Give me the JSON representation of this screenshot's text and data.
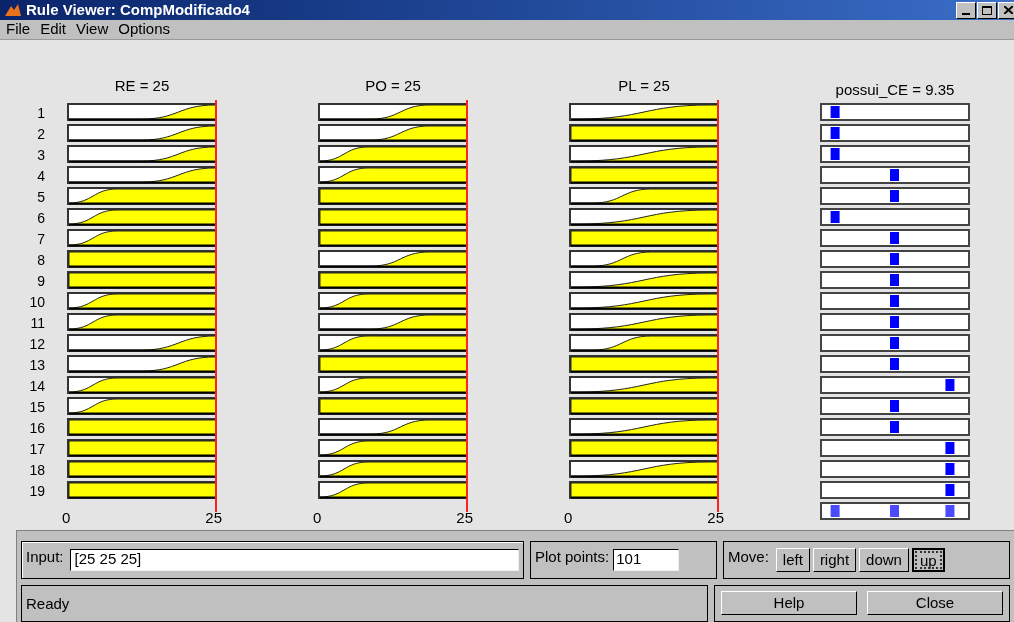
{
  "window": {
    "title": "Rule Viewer: CompModificado4"
  },
  "menu": [
    "File",
    "Edit",
    "View",
    "Options"
  ],
  "rule_numbers": [
    "1",
    "2",
    "3",
    "4",
    "5",
    "6",
    "7",
    "8",
    "9",
    "10",
    "11",
    "12",
    "13",
    "14",
    "15",
    "16",
    "17",
    "18",
    "19"
  ],
  "inputs": [
    {
      "label": "RE = 25",
      "axis_min": "0",
      "axis_max": "25",
      "rules": [
        {
          "kind": "late"
        },
        {
          "kind": "late"
        },
        {
          "kind": "late"
        },
        {
          "kind": "late"
        },
        {
          "kind": "early"
        },
        {
          "kind": "early"
        },
        {
          "kind": "early"
        },
        {
          "kind": "full"
        },
        {
          "kind": "full"
        },
        {
          "kind": "early"
        },
        {
          "kind": "early"
        },
        {
          "kind": "late"
        },
        {
          "kind": "late"
        },
        {
          "kind": "early"
        },
        {
          "kind": "early"
        },
        {
          "kind": "full"
        },
        {
          "kind": "full"
        },
        {
          "kind": "full"
        },
        {
          "kind": "full"
        }
      ]
    },
    {
      "label": "PO = 25",
      "axis_min": "0",
      "axis_max": "25",
      "rules": [
        {
          "kind": "mid"
        },
        {
          "kind": "mid"
        },
        {
          "kind": "early"
        },
        {
          "kind": "early"
        },
        {
          "kind": "full"
        },
        {
          "kind": "full"
        },
        {
          "kind": "full"
        },
        {
          "kind": "mid"
        },
        {
          "kind": "full"
        },
        {
          "kind": "early"
        },
        {
          "kind": "mid"
        },
        {
          "kind": "early"
        },
        {
          "kind": "full"
        },
        {
          "kind": "early"
        },
        {
          "kind": "full"
        },
        {
          "kind": "mid"
        },
        {
          "kind": "early"
        },
        {
          "kind": "early"
        },
        {
          "kind": "early"
        }
      ]
    },
    {
      "label": "PL = 25",
      "axis_min": "0",
      "axis_max": "25",
      "rules": [
        {
          "kind": "ramp"
        },
        {
          "kind": "full"
        },
        {
          "kind": "ramp"
        },
        {
          "kind": "full"
        },
        {
          "kind": "midlong"
        },
        {
          "kind": "ramp"
        },
        {
          "kind": "full"
        },
        {
          "kind": "midlong"
        },
        {
          "kind": "ramp"
        },
        {
          "kind": "ramp"
        },
        {
          "kind": "ramp"
        },
        {
          "kind": "midlong"
        },
        {
          "kind": "full"
        },
        {
          "kind": "ramp"
        },
        {
          "kind": "full"
        },
        {
          "kind": "ramp"
        },
        {
          "kind": "full"
        },
        {
          "kind": "ramp"
        },
        {
          "kind": "full"
        }
      ]
    }
  ],
  "output": {
    "label": "possui_CE = 9.35",
    "rules": [
      {
        "kind": "low"
      },
      {
        "kind": "low"
      },
      {
        "kind": "low"
      },
      {
        "kind": "mid"
      },
      {
        "kind": "mid"
      },
      {
        "kind": "low"
      },
      {
        "kind": "mid"
      },
      {
        "kind": "mid"
      },
      {
        "kind": "mid"
      },
      {
        "kind": "mid"
      },
      {
        "kind": "mid"
      },
      {
        "kind": "mid"
      },
      {
        "kind": "mid"
      },
      {
        "kind": "high"
      },
      {
        "kind": "mid"
      },
      {
        "kind": "mid"
      },
      {
        "kind": "high"
      },
      {
        "kind": "high"
      },
      {
        "kind": "high"
      }
    ],
    "aggregate": [
      {
        "kind": "low"
      },
      {
        "kind": "mid"
      },
      {
        "kind": "high"
      }
    ]
  },
  "input": {
    "label": "Input:",
    "value": "[25 25 25]"
  },
  "plot_points": {
    "label": "Plot points:",
    "value": "101"
  },
  "move": {
    "label": "Move:",
    "buttons": [
      {
        "label": "left",
        "focused": false
      },
      {
        "label": "right",
        "focused": false
      },
      {
        "label": "down",
        "focused": false
      },
      {
        "label": "up",
        "focused": true
      }
    ]
  },
  "status": "Ready",
  "buttons": [
    "Help",
    "Close"
  ]
}
